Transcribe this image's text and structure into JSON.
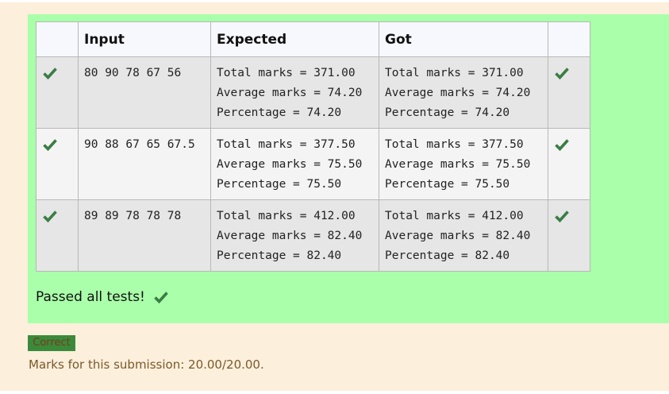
{
  "colors": {
    "page_background": "#fcefdc",
    "result_background": "#aaffaa",
    "check_color": "#3a7d44",
    "badge_background": "#3b8a3b",
    "marks_text": "#7a5a2a"
  },
  "table": {
    "headers": {
      "status": "",
      "input": "Input",
      "expected": "Expected",
      "got": "Got",
      "status2": ""
    },
    "rows": [
      {
        "status_icon": "check-icon",
        "input": "80 90 78 67 56",
        "expected": "Total marks = 371.00\nAverage marks = 74.20\nPercentage = 74.20",
        "got": "Total marks = 371.00\nAverage marks = 74.20\nPercentage = 74.20",
        "status2_icon": "check-icon"
      },
      {
        "status_icon": "check-icon",
        "input": "90 88 67 65 67.5",
        "expected": "Total marks = 377.50\nAverage marks = 75.50\nPercentage = 75.50",
        "got": "Total marks = 377.50\nAverage marks = 75.50\nPercentage = 75.50",
        "status2_icon": "check-icon"
      },
      {
        "status_icon": "check-icon",
        "input": "89 89 78 78 78",
        "expected": "Total marks = 412.00\nAverage marks = 82.40\nPercentage = 82.40",
        "got": "Total marks = 412.00\nAverage marks = 82.40\nPercentage = 82.40",
        "status2_icon": "check-icon"
      }
    ]
  },
  "summary": {
    "passed_text": "Passed all tests!",
    "passed_icon": "check-icon"
  },
  "badge": {
    "label": "Correct"
  },
  "marks": {
    "text": "Marks for this submission: 20.00/20.00."
  }
}
